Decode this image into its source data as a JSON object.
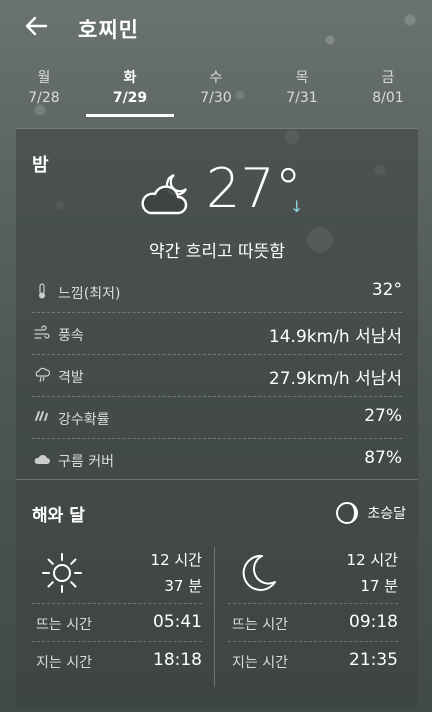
{
  "header": {
    "title": "호찌민",
    "back_icon": "arrow-left-icon"
  },
  "tabs": [
    {
      "dow": "월",
      "date": "7/28"
    },
    {
      "dow": "화",
      "date": "7/29",
      "active": true
    },
    {
      "dow": "수",
      "date": "7/30"
    },
    {
      "dow": "목",
      "date": "7/31"
    },
    {
      "dow": "금",
      "date": "8/01"
    }
  ],
  "forecast": {
    "period": "밤",
    "icon": "partly-cloudy-night-icon",
    "temperature": "27°",
    "trend_arrow": "↓",
    "description": "약간 흐리고 따뜻함",
    "details": [
      {
        "icon": "thermometer-icon",
        "label": "느낌(최저)",
        "value": "32°"
      },
      {
        "icon": "wind-icon",
        "label": "풍속",
        "value": "14.9km/h 서남서"
      },
      {
        "icon": "gust-icon",
        "label": "격발",
        "value": "27.9km/h 서남서"
      },
      {
        "icon": "rain-icon",
        "label": "강수확률",
        "value": "27%"
      },
      {
        "icon": "cloud-icon",
        "label": "구름 커버",
        "value": "87%"
      }
    ]
  },
  "sun_moon": {
    "title": "해와 달",
    "moon_phase": "초승달",
    "sun": {
      "duration_hours": "12 시간",
      "duration_minutes": "37 분",
      "rise_label": "뜨는 시간",
      "rise": "05:41",
      "set_label": "지는 시간",
      "set": "18:18"
    },
    "moon": {
      "duration_hours": "12 시간",
      "duration_minutes": "17 분",
      "rise_label": "뜨는 시간",
      "rise": "09:18",
      "set_label": "지는 시간",
      "set": "21:35"
    }
  }
}
